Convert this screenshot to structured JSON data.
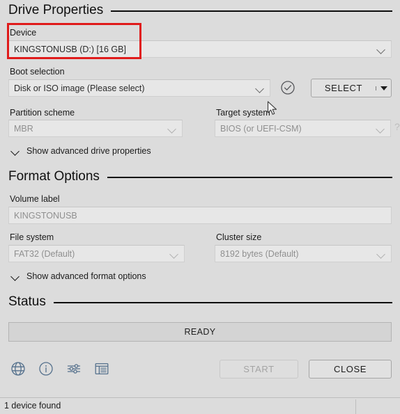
{
  "window": {
    "background_color": "#dcdcdc",
    "highlight_color": "#e01b1b",
    "icon_color": "#55718d"
  },
  "drive_properties": {
    "heading": "Drive Properties",
    "device": {
      "label": "Device",
      "value": "KINGSTONUSB (D:) [16 GB]",
      "chevron_icon": "chevron-down-icon",
      "highlighted": true
    },
    "boot_selection": {
      "label": "Boot selection",
      "value": "Disk or ISO image (Please select)",
      "chevron_icon": "chevron-down-icon"
    },
    "check_icon": "check-circle-icon",
    "select_button": {
      "label": "SELECT",
      "dropdown_icon": "triangle-down-icon"
    },
    "partition_scheme": {
      "label": "Partition scheme",
      "value": "MBR",
      "chevron_icon": "chevron-down-icon"
    },
    "target_system": {
      "label": "Target system",
      "value": "BIOS (or UEFI-CSM)",
      "chevron_icon": "chevron-down-icon",
      "help_icon": "question-mark-icon",
      "help_glyph": "?"
    },
    "advanced_toggle": {
      "label": "Show advanced drive properties",
      "caret_icon": "chevron-down-icon"
    }
  },
  "format_options": {
    "heading": "Format Options",
    "volume_label": {
      "label": "Volume label",
      "value": "KINGSTONUSB"
    },
    "file_system": {
      "label": "File system",
      "value": "FAT32 (Default)",
      "chevron_icon": "chevron-down-icon"
    },
    "cluster_size": {
      "label": "Cluster size",
      "value": "8192 bytes (Default)",
      "chevron_icon": "chevron-down-icon"
    },
    "advanced_toggle": {
      "label": "Show advanced format options",
      "caret_icon": "chevron-down-icon"
    }
  },
  "status": {
    "heading": "Status",
    "progress_text": "READY"
  },
  "toolbar": {
    "icons": [
      {
        "name": "globe-icon",
        "title": "Language"
      },
      {
        "name": "info-icon",
        "title": "About"
      },
      {
        "name": "settings-sliders-icon",
        "title": "Settings"
      },
      {
        "name": "log-list-icon",
        "title": "Log"
      }
    ],
    "start_button": {
      "label": "START",
      "enabled": false
    },
    "close_button": {
      "label": "CLOSE",
      "enabled": true
    }
  },
  "footer": {
    "message": "1 device found"
  }
}
